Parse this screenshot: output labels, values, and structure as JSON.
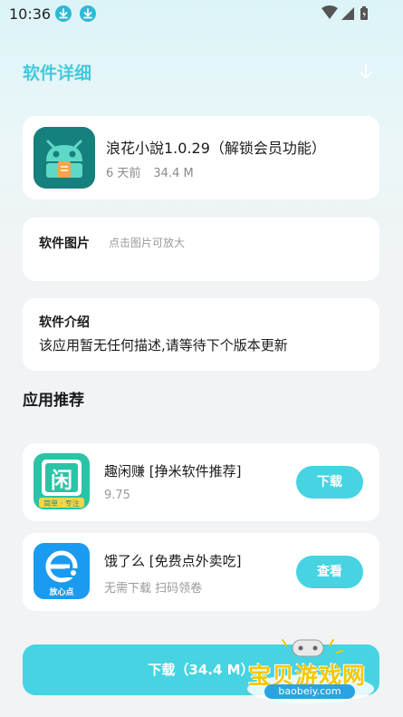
{
  "status_bar": {
    "time": "10:36"
  },
  "header": {
    "title": "软件详细"
  },
  "app": {
    "name": "浪花小說1.0.29（解锁会员功能）",
    "age": "6 天前",
    "size": "34.4 M"
  },
  "screenshots": {
    "heading": "软件图片",
    "hint": "点击图片可放大"
  },
  "intro": {
    "heading": "软件介绍",
    "text": "该应用暂无任何描述,请等待下个版本更新"
  },
  "recommend": {
    "title": "应用推荐",
    "items": [
      {
        "name": "趣闲赚 [挣米软件推荐]",
        "sub": "9.75",
        "button": "下载",
        "icon": "qu-xian-zhuan-icon",
        "icon_caption": "简单 · 专注",
        "icon_char": "闲"
      },
      {
        "name": "饿了么 [免费点外卖吃]",
        "sub": "无需下载 扫码领卷",
        "button": "查看",
        "icon": "ele-me-icon",
        "icon_caption": "放心点"
      }
    ]
  },
  "bottom_button": {
    "label": "下载（34.4 M）"
  },
  "watermark": {
    "title": "宝贝游戏网",
    "url": "baobeiy.com"
  },
  "colors": {
    "accent": "#46d3e2",
    "title": "#44c9dc",
    "app_icon_bg": "#16807c"
  }
}
